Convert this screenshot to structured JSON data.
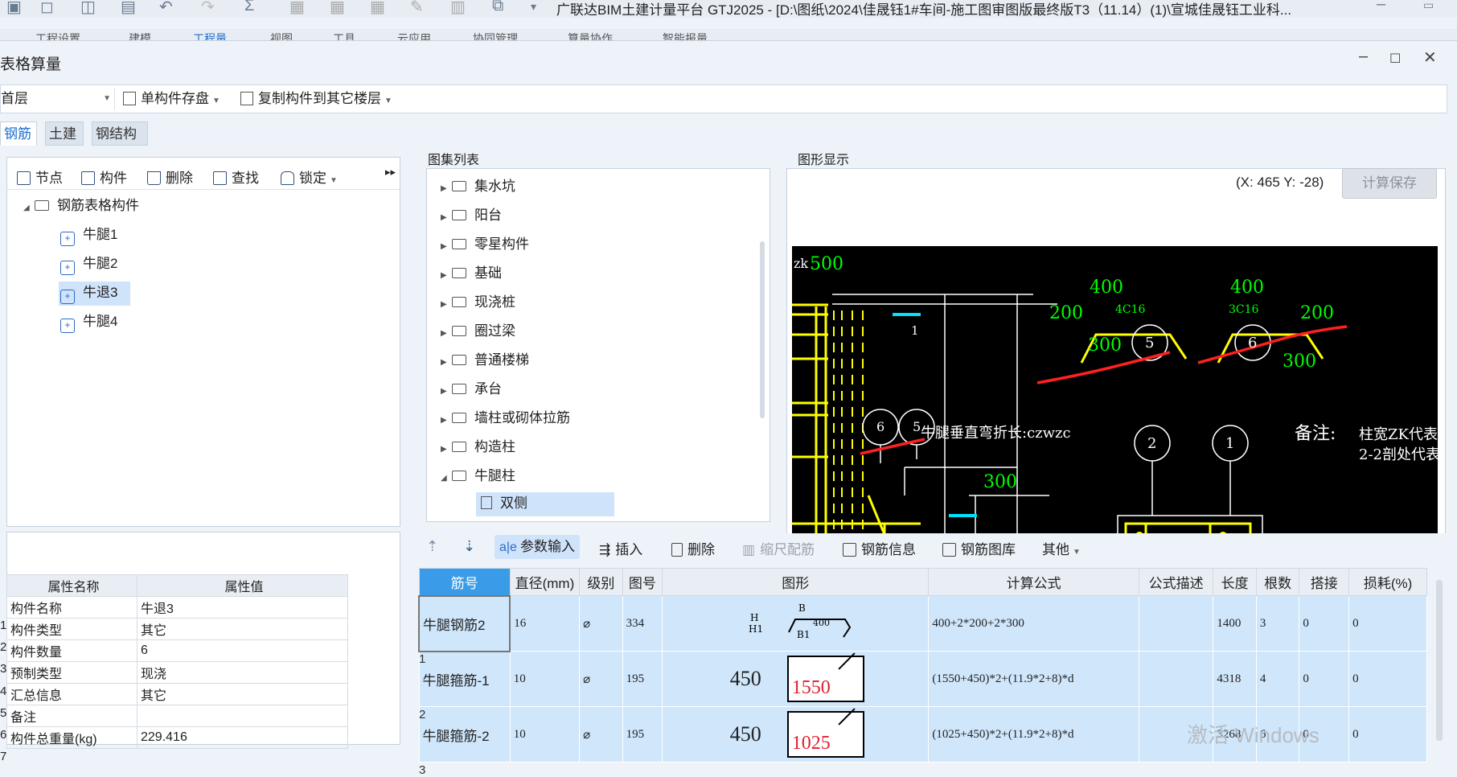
{
  "app": {
    "title": "广联达BIM土建计量平台 GTJ2025 - [D:\\图纸\\2024\\佳晟钰1#车间-施工图审图版最终版T3（11.14）(1)\\宣城佳晟钰工业科...",
    "menu": [
      "工程设置",
      "建模",
      "工程量",
      "视图",
      "工具",
      "云应用",
      "协同管理",
      "算量协作",
      "智能报量"
    ]
  },
  "dialog": {
    "title": "表格算量",
    "floor_select": "首层",
    "save_component": "单构件存盘",
    "copy_to_floors": "复制构件到其它楼层",
    "tabs": [
      "钢筋",
      "土建",
      "钢结构"
    ]
  },
  "tree": {
    "toolbar": [
      "节点",
      "构件",
      "删除",
      "查找",
      "锁定"
    ],
    "root": "钢筋表格构件",
    "items": [
      "牛腿1",
      "牛腿2",
      "牛退3",
      "牛腿4"
    ]
  },
  "properties": {
    "headers": [
      "属性名称",
      "属性值"
    ],
    "rows": [
      {
        "num": "1",
        "name": "构件名称",
        "value": "牛退3"
      },
      {
        "num": "2",
        "name": "构件类型",
        "value": "其它"
      },
      {
        "num": "3",
        "name": "构件数量",
        "value": "6"
      },
      {
        "num": "4",
        "name": "预制类型",
        "value": "现浇"
      },
      {
        "num": "5",
        "name": "汇总信息",
        "value": "其它"
      },
      {
        "num": "6",
        "name": "备注",
        "value": ""
      },
      {
        "num": "7",
        "name": "构件总重量(kg)",
        "value": "229.416"
      }
    ]
  },
  "atlas": {
    "label": "图集列表",
    "items": [
      "集水坑",
      "阳台",
      "零星构件",
      "基础",
      "现浇桩",
      "圈过梁",
      "普通楼梯",
      "承台",
      "墙柱或砌体拉筋",
      "构造柱",
      "牛腿柱"
    ],
    "child": "双侧"
  },
  "graphic": {
    "label": "图形显示",
    "coords": "(X: 465 Y: -28)",
    "calc_save": "计算保存",
    "texts": {
      "zk": "zk",
      "t500": "500",
      "t400a": "400",
      "t400b": "400",
      "t200a": "200",
      "t200b": "200",
      "t4c16": "4C16",
      "t3c16": "3C16",
      "t300a": "300",
      "t300b": "300",
      "t300c": "300",
      "c1": "1",
      "c2": "2",
      "c5": "5",
      "c6": "6",
      "label1": "1",
      "note_czwzc": "牛腿垂直弯折长:czwzc",
      "beizhu": "备注:",
      "zk_note": "柱宽ZK代表",
      "section_note": "2-2剖处代表"
    }
  },
  "rebar_toolbar": [
    "参数输入",
    "插入",
    "删除",
    "缩尺配筋",
    "钢筋信息",
    "钢筋图库",
    "其他"
  ],
  "rebar_table": {
    "headers": [
      "筋号",
      "直径(mm)",
      "级别",
      "图号",
      "图形",
      "计算公式",
      "公式描述",
      "长度",
      "根数",
      "搭接",
      "损耗(%)"
    ],
    "rows": [
      {
        "num": "1",
        "name": "牛腿钢筋2",
        "dia": "16",
        "grade": "⌀",
        "fig": "334",
        "shape_h": "H",
        "shape_h1": "H1",
        "shape_b": "B",
        "shape_b1": "B1",
        "shape_v": "400",
        "formula": "400+2*200+2*300",
        "desc": "",
        "len": "1400",
        "count": "3",
        "lap": "0",
        "loss": "0"
      },
      {
        "num": "2",
        "name": "牛腿箍筋-1",
        "dia": "10",
        "grade": "⌀",
        "fig": "195",
        "shape_a": "450",
        "shape_b": "1550",
        "formula": "(1550+450)*2+(11.9*2+8)*d",
        "desc": "",
        "len": "4318",
        "count": "4",
        "lap": "0",
        "loss": "0"
      },
      {
        "num": "3",
        "name": "牛腿箍筋-2",
        "dia": "10",
        "grade": "⌀",
        "fig": "195",
        "shape_a": "450",
        "shape_b": "1025",
        "formula": "(1025+450)*2+(11.9*2+8)*d",
        "desc": "",
        "len": "3268",
        "count": "6",
        "lap": "0",
        "loss": "0"
      }
    ]
  },
  "watermark": "激活 Windows",
  "colors": {
    "accent": "#1f6fd0",
    "header_blue": "#3a9ce8",
    "row_blue": "#cfe6fb",
    "cad_bg": "#000000",
    "cad_yellow": "#ffff00",
    "cad_green": "#00ff00",
    "cad_red": "#ff2020",
    "cad_cyan": "#00e0ff"
  }
}
